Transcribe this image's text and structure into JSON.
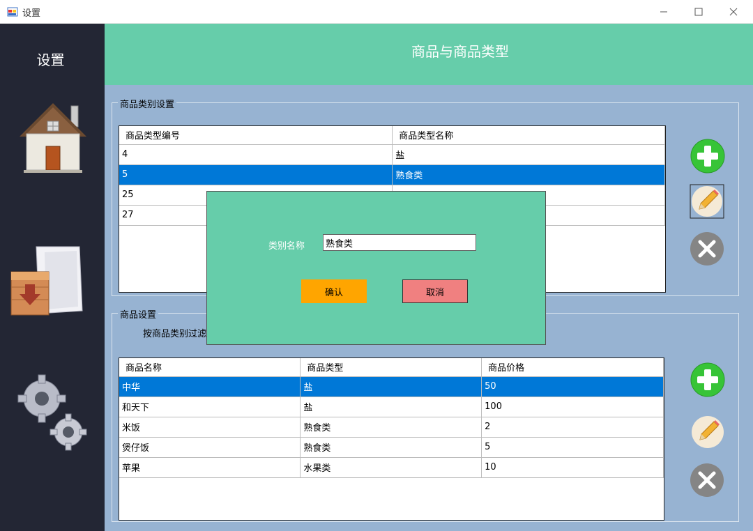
{
  "window": {
    "title": "设置"
  },
  "sidebar": {
    "title": "设置",
    "items": [
      {
        "icon": "home-icon"
      },
      {
        "icon": "import-icon"
      },
      {
        "icon": "settings-gears-icon"
      }
    ]
  },
  "header": {
    "title": "商品与商品类型"
  },
  "category_group": {
    "legend": "商品类别设置",
    "columns": [
      "商品类型编号",
      "商品类型名称"
    ],
    "rows": [
      {
        "id": "4",
        "name": "盐"
      },
      {
        "id": "5",
        "name": "熟食类"
      },
      {
        "id": "25",
        "name": ""
      },
      {
        "id": "27",
        "name": ""
      }
    ],
    "selected_index": 1
  },
  "product_group": {
    "legend": "商品设置",
    "filter_label": "按商品类别过滤",
    "columns": [
      "商品名称",
      "商品类型",
      "商品价格"
    ],
    "rows": [
      {
        "name": "中华",
        "type": "盐",
        "price": "50"
      },
      {
        "name": "和天下",
        "type": "盐",
        "price": "100"
      },
      {
        "name": "米饭",
        "type": "熟食类",
        "price": "2"
      },
      {
        "name": "煲仔饭",
        "type": "熟食类",
        "price": "5"
      },
      {
        "name": "苹果",
        "type": "水果类",
        "price": "10"
      }
    ],
    "selected_index": 0
  },
  "dialog": {
    "label": "类别名称",
    "value": "熟食类",
    "ok_label": "确认",
    "cancel_label": "取消"
  },
  "colors": {
    "sidebar": "#232634",
    "header": "#66cdaa",
    "content": "#97b3d2",
    "selection": "#0078d7",
    "ok": "#ffa500",
    "cancel": "#f08080"
  }
}
